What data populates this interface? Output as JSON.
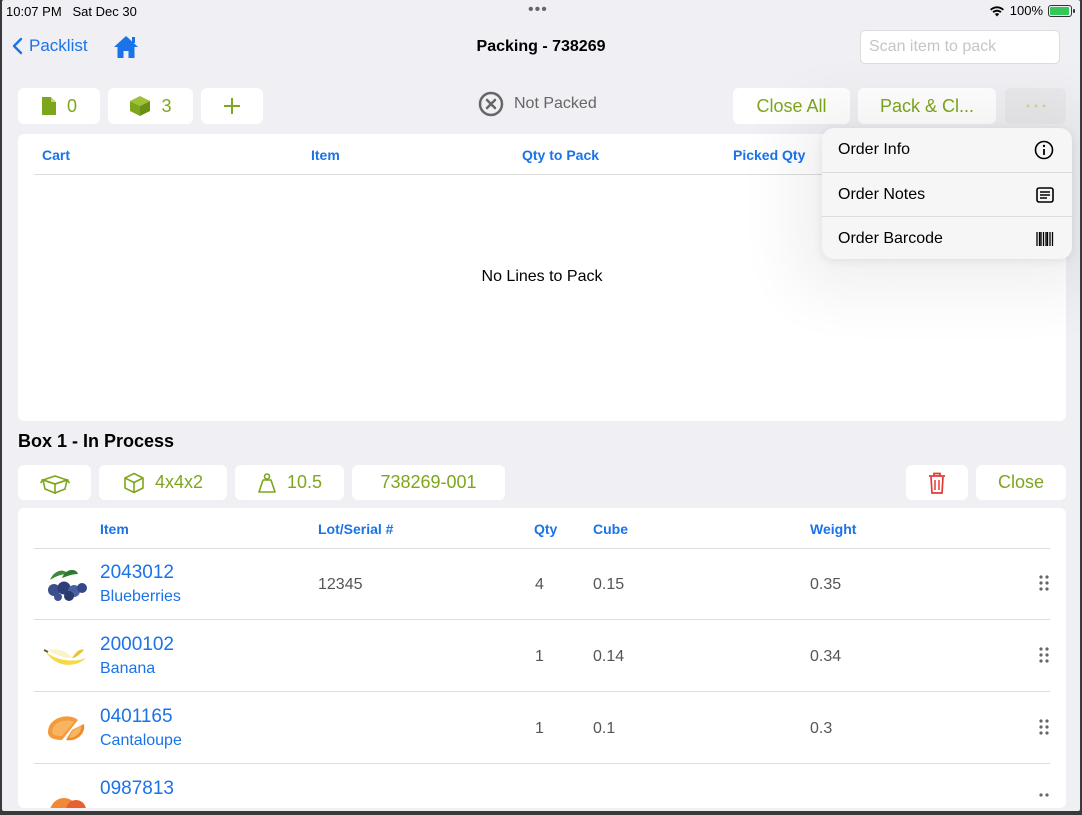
{
  "status_bar": {
    "time": "10:07 PM",
    "date": "Sat Dec 30",
    "battery_text": "100%",
    "wifi_icon": "wifi-icon",
    "battery_level": 1.0
  },
  "nav": {
    "back_label": "Packlist",
    "title": "Packing - 738269",
    "scan_placeholder": "Scan item to pack"
  },
  "toolbar": {
    "docs_count": "0",
    "boxes_count": "3",
    "add_icon": "plus-icon",
    "status_text": "Not Packed",
    "close_all": "Close All",
    "pack_close": "Pack & Cl...",
    "more_icon": "more-icon"
  },
  "lines_table": {
    "columns": [
      "Cart",
      "Item",
      "Qty to Pack",
      "Picked Qty"
    ],
    "empty_text": "No Lines to Pack"
  },
  "menu": {
    "items": [
      {
        "label": "Order Info",
        "icon": "info-icon"
      },
      {
        "label": "Order Notes",
        "icon": "notes-icon"
      },
      {
        "label": "Order Barcode",
        "icon": "barcode-icon"
      }
    ]
  },
  "box": {
    "title": "Box 1 - In Process",
    "dimensions": "4x4x2",
    "weight": "10.5",
    "box_id": "738269-001",
    "close_label": "Close",
    "columns": [
      "Item",
      "Lot/Serial #",
      "Qty",
      "Cube",
      "Weight"
    ],
    "rows": [
      {
        "code": "2043012",
        "name": "Blueberries",
        "lot": "12345",
        "qty": "4",
        "cube": "0.15",
        "weight": "0.35",
        "image": "blueberries"
      },
      {
        "code": "2000102",
        "name": "Banana",
        "lot": "",
        "qty": "1",
        "cube": "0.14",
        "weight": "0.34",
        "image": "banana"
      },
      {
        "code": "0401165",
        "name": "Cantaloupe",
        "lot": "",
        "qty": "1",
        "cube": "0.1",
        "weight": "0.3",
        "image": "cantaloupe"
      },
      {
        "code": "0987813",
        "name": "",
        "lot": "",
        "qty": "",
        "cube": "",
        "weight": "",
        "image": "peach"
      }
    ]
  },
  "colors": {
    "accent_green": "#7ea61c",
    "link_blue": "#1a73e8",
    "danger_red": "#e53935",
    "background": "#efeff4"
  }
}
